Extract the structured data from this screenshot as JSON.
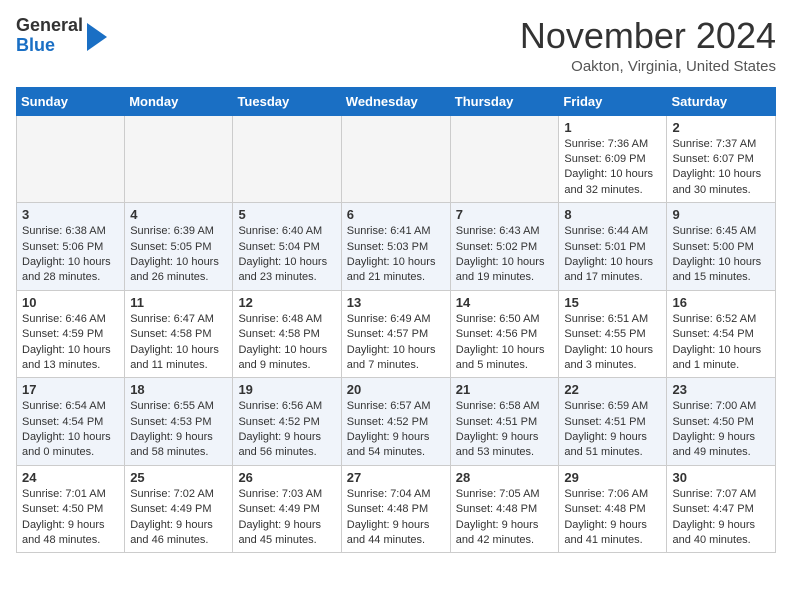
{
  "header": {
    "logo_line1": "General",
    "logo_line2": "Blue",
    "month": "November 2024",
    "location": "Oakton, Virginia, United States"
  },
  "weekdays": [
    "Sunday",
    "Monday",
    "Tuesday",
    "Wednesday",
    "Thursday",
    "Friday",
    "Saturday"
  ],
  "weeks": [
    [
      {
        "day": "",
        "info": ""
      },
      {
        "day": "",
        "info": ""
      },
      {
        "day": "",
        "info": ""
      },
      {
        "day": "",
        "info": ""
      },
      {
        "day": "",
        "info": ""
      },
      {
        "day": "1",
        "info": "Sunrise: 7:36 AM\nSunset: 6:09 PM\nDaylight: 10 hours\nand 32 minutes."
      },
      {
        "day": "2",
        "info": "Sunrise: 7:37 AM\nSunset: 6:07 PM\nDaylight: 10 hours\nand 30 minutes."
      }
    ],
    [
      {
        "day": "3",
        "info": "Sunrise: 6:38 AM\nSunset: 5:06 PM\nDaylight: 10 hours\nand 28 minutes."
      },
      {
        "day": "4",
        "info": "Sunrise: 6:39 AM\nSunset: 5:05 PM\nDaylight: 10 hours\nand 26 minutes."
      },
      {
        "day": "5",
        "info": "Sunrise: 6:40 AM\nSunset: 5:04 PM\nDaylight: 10 hours\nand 23 minutes."
      },
      {
        "day": "6",
        "info": "Sunrise: 6:41 AM\nSunset: 5:03 PM\nDaylight: 10 hours\nand 21 minutes."
      },
      {
        "day": "7",
        "info": "Sunrise: 6:43 AM\nSunset: 5:02 PM\nDaylight: 10 hours\nand 19 minutes."
      },
      {
        "day": "8",
        "info": "Sunrise: 6:44 AM\nSunset: 5:01 PM\nDaylight: 10 hours\nand 17 minutes."
      },
      {
        "day": "9",
        "info": "Sunrise: 6:45 AM\nSunset: 5:00 PM\nDaylight: 10 hours\nand 15 minutes."
      }
    ],
    [
      {
        "day": "10",
        "info": "Sunrise: 6:46 AM\nSunset: 4:59 PM\nDaylight: 10 hours\nand 13 minutes."
      },
      {
        "day": "11",
        "info": "Sunrise: 6:47 AM\nSunset: 4:58 PM\nDaylight: 10 hours\nand 11 minutes."
      },
      {
        "day": "12",
        "info": "Sunrise: 6:48 AM\nSunset: 4:58 PM\nDaylight: 10 hours\nand 9 minutes."
      },
      {
        "day": "13",
        "info": "Sunrise: 6:49 AM\nSunset: 4:57 PM\nDaylight: 10 hours\nand 7 minutes."
      },
      {
        "day": "14",
        "info": "Sunrise: 6:50 AM\nSunset: 4:56 PM\nDaylight: 10 hours\nand 5 minutes."
      },
      {
        "day": "15",
        "info": "Sunrise: 6:51 AM\nSunset: 4:55 PM\nDaylight: 10 hours\nand 3 minutes."
      },
      {
        "day": "16",
        "info": "Sunrise: 6:52 AM\nSunset: 4:54 PM\nDaylight: 10 hours\nand 1 minute."
      }
    ],
    [
      {
        "day": "17",
        "info": "Sunrise: 6:54 AM\nSunset: 4:54 PM\nDaylight: 10 hours\nand 0 minutes."
      },
      {
        "day": "18",
        "info": "Sunrise: 6:55 AM\nSunset: 4:53 PM\nDaylight: 9 hours\nand 58 minutes."
      },
      {
        "day": "19",
        "info": "Sunrise: 6:56 AM\nSunset: 4:52 PM\nDaylight: 9 hours\nand 56 minutes."
      },
      {
        "day": "20",
        "info": "Sunrise: 6:57 AM\nSunset: 4:52 PM\nDaylight: 9 hours\nand 54 minutes."
      },
      {
        "day": "21",
        "info": "Sunrise: 6:58 AM\nSunset: 4:51 PM\nDaylight: 9 hours\nand 53 minutes."
      },
      {
        "day": "22",
        "info": "Sunrise: 6:59 AM\nSunset: 4:51 PM\nDaylight: 9 hours\nand 51 minutes."
      },
      {
        "day": "23",
        "info": "Sunrise: 7:00 AM\nSunset: 4:50 PM\nDaylight: 9 hours\nand 49 minutes."
      }
    ],
    [
      {
        "day": "24",
        "info": "Sunrise: 7:01 AM\nSunset: 4:50 PM\nDaylight: 9 hours\nand 48 minutes."
      },
      {
        "day": "25",
        "info": "Sunrise: 7:02 AM\nSunset: 4:49 PM\nDaylight: 9 hours\nand 46 minutes."
      },
      {
        "day": "26",
        "info": "Sunrise: 7:03 AM\nSunset: 4:49 PM\nDaylight: 9 hours\nand 45 minutes."
      },
      {
        "day": "27",
        "info": "Sunrise: 7:04 AM\nSunset: 4:48 PM\nDaylight: 9 hours\nand 44 minutes."
      },
      {
        "day": "28",
        "info": "Sunrise: 7:05 AM\nSunset: 4:48 PM\nDaylight: 9 hours\nand 42 minutes."
      },
      {
        "day": "29",
        "info": "Sunrise: 7:06 AM\nSunset: 4:48 PM\nDaylight: 9 hours\nand 41 minutes."
      },
      {
        "day": "30",
        "info": "Sunrise: 7:07 AM\nSunset: 4:47 PM\nDaylight: 9 hours\nand 40 minutes."
      }
    ]
  ]
}
